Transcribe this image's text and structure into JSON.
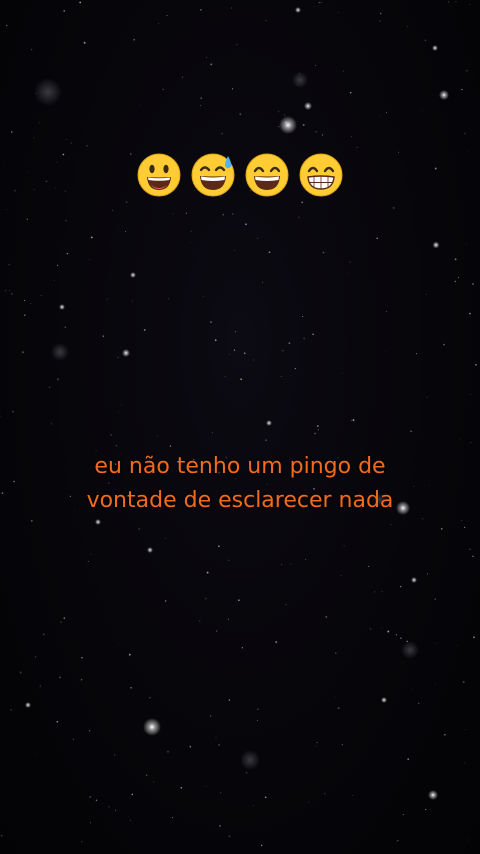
{
  "caption": {
    "line1": "eu não tenho um pingo de",
    "line2": "vontade de esclarecer nada"
  },
  "emojis": [
    "grinning-face-with-big-eyes",
    "grinning-face-with-sweat",
    "grinning-face-with-smiling-eyes",
    "beaming-face-with-smiling-eyes"
  ],
  "colors": {
    "background": "#06050a",
    "caption": "#f26a1c",
    "emoji_yellow": "#ffcc33",
    "emoji_outline": "#e0a21a",
    "sweat": "#4fb3f0"
  }
}
